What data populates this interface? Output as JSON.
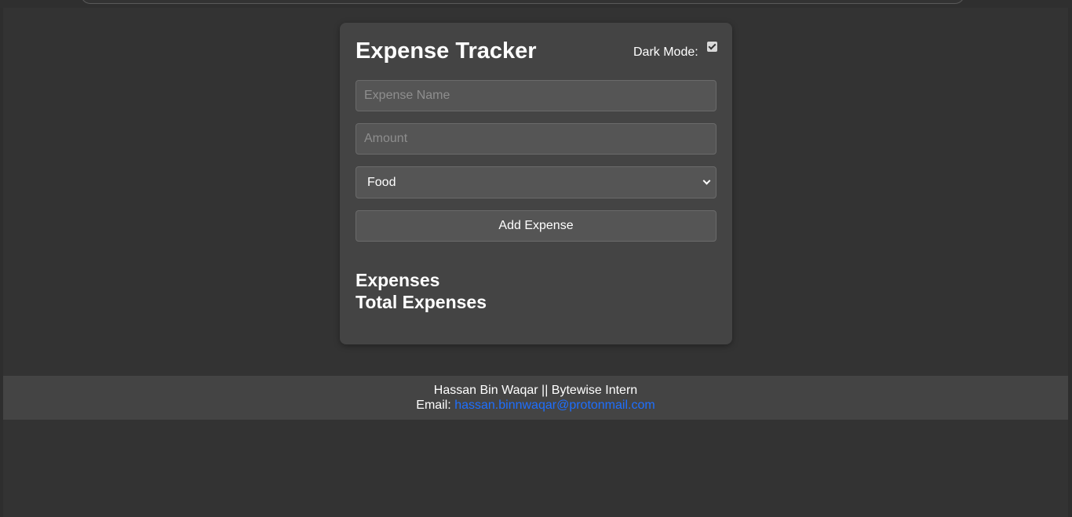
{
  "app": {
    "title": "Expense Tracker",
    "dark_mode_label": "Dark Mode:",
    "dark_mode_checked": true
  },
  "form": {
    "name_placeholder": "Expense Name",
    "name_value": "",
    "amount_placeholder": "Amount",
    "amount_value": "",
    "category_selected": "Food",
    "add_button_label": "Add Expense"
  },
  "sections": {
    "expenses_heading": "Expenses",
    "total_heading": "Total Expenses"
  },
  "footer": {
    "credit": "Hassan Bin Waqar || Bytewise Intern",
    "email_label": "Email:",
    "email_link": "hassan.binnwaqar@protonmail.com",
    "link_color": "#1e6fff"
  },
  "colors": {
    "page_background": "#333333",
    "card_background": "#444444",
    "field_background": "#555555"
  }
}
